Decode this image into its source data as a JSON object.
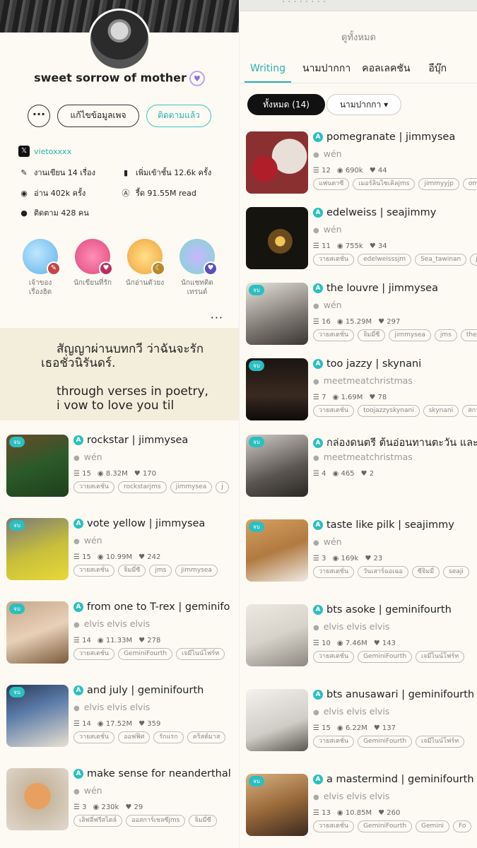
{
  "profile": {
    "name": "sweet sorrow of mother",
    "more_label": "···",
    "edit_label": "แก้ไขข้อมูลเพจ",
    "follow_label": "ติดตามแล้ว",
    "x_handle": "vietoxxxx",
    "stats": {
      "works": "งานเขียน 14 เรื่อง",
      "shelf": "เพิ่มเข้าชั้น 12.6k ครั้ง",
      "reads": "อ่าน 402k ครั้ง",
      "coins": "รี้ด 91.55M read",
      "followers": "ติดตาม 428 คน"
    },
    "badges": [
      {
        "line1": "เจ้าของ",
        "line2": "เรื่องฮิต"
      },
      {
        "line1": "นักเขียนที่รัก",
        "line2": ""
      },
      {
        "line1": "นักอ่านตัวยง",
        "line2": ""
      },
      {
        "line1": "นักแชทติด",
        "line2": "เทรนด์"
      }
    ],
    "bio_thai": "สัญญาผ่านบทกวี ว่าฉันจะรักเธอชั่วนิรันดร์.",
    "bio_en": "through verses in poetry, i vow to love you til"
  },
  "right_top": {
    "see_all": "ดูทั้งหมด",
    "tabs": [
      "Writing",
      "นามปากกา",
      "คอลเลคชัน",
      "อีบุ๊ก"
    ],
    "filter_all": "ทั้งหมด (14)",
    "filter_pen": "นามปากกา"
  },
  "done_label": "จบ",
  "stories_b": [
    {
      "title": "pomegranate | jimmysea",
      "author": "wén",
      "chapters": "12",
      "views": "690k",
      "likes": "44",
      "tags": [
        "แฟนตาซี",
        "เมอร์ลินไซเคิลjms",
        "jimmyyjp",
        "omeg"
      ],
      "done": false
    },
    {
      "title": "edelweiss | seajimmy",
      "author": "wén",
      "chapters": "11",
      "views": "755k",
      "likes": "34",
      "tags": [
        "วายสเตชั่น",
        "edelweisssjm",
        "Sea_tawinan",
        "jim"
      ],
      "done": false
    },
    {
      "title": "the louvre | jimmysea",
      "author": "wén",
      "chapters": "16",
      "views": "15.29M",
      "likes": "297",
      "tags": [
        "วายสเตชั่น",
        "จิมมี่ซี",
        "jimmysea",
        "jms",
        "thelou"
      ],
      "done": true
    },
    {
      "title": "too jazzy | skynani",
      "author": "meetmeatchristmas",
      "chapters": "7",
      "views": "1.69M",
      "likes": "78",
      "tags": [
        "วายสเตชั่น",
        "toojazzyskynani",
        "skynani",
        "สกาย"
      ],
      "done": true
    }
  ],
  "stories_c": [
    {
      "title": "rockstar | jimmysea",
      "author": "wén",
      "chapters": "15",
      "views": "8.32M",
      "likes": "170",
      "tags": [
        "วายสเตชั่น",
        "rockstarjms",
        "jimmysea",
        "j"
      ],
      "done": true
    },
    {
      "title": "vote yellow | jimmysea",
      "author": "wén",
      "chapters": "15",
      "views": "10.99M",
      "likes": "242",
      "tags": [
        "วายสเตชั่น",
        "จิมมี่ซี",
        "jms",
        "jimmysea"
      ],
      "done": true
    },
    {
      "title": "from one to T-rex | geminifo",
      "author": "elvis elvis elvis",
      "chapters": "14",
      "views": "11.33M",
      "likes": "278",
      "tags": [
        "วายสเตชั่น",
        "GeminiFourth",
        "เจมีไนน์โฟร์ท"
      ],
      "done": true
    },
    {
      "title": "and july | geminifourth",
      "author": "elvis elvis elvis",
      "chapters": "14",
      "views": "17.52M",
      "likes": "359",
      "tags": [
        "วายสเตชั่น",
        "ออฟฟิศ",
        "รักแรก",
        "คริสต์มาส"
      ],
      "done": true
    },
    {
      "title": "make sense for neanderthal",
      "author": "wén",
      "chapters": "3",
      "views": "230k",
      "likes": "29",
      "tags": [
        "เลิฟลี่ฟรีสไตล์",
        "ออสการ์เชลซีjms",
        "จิมมี่ซี"
      ],
      "done": false
    }
  ],
  "stories_d": [
    {
      "title": "กล่องดนตรี ต้นอ่อนทานตะวัน และส",
      "author": "meetmeatchristmas",
      "chapters": "4",
      "views": "465",
      "likes": "2",
      "tags": [],
      "done": true
    },
    {
      "title": "taste like pilk | seajimmy",
      "author": "wén",
      "chapters": "3",
      "views": "169k",
      "likes": "23",
      "tags": [
        "วายสเตชั่น",
        "วันเสาร์ฉอเฉอ",
        "ซีจิมมี่",
        "seaji"
      ],
      "done": true
    },
    {
      "title": "bts asoke | geminifourth",
      "author": "elvis elvis elvis",
      "chapters": "10",
      "views": "7.46M",
      "likes": "143",
      "tags": [
        "วายสเตชั่น",
        "GeminiFourth",
        "เจมีไนน์โฟร์ท"
      ],
      "done": false
    },
    {
      "title": "bts anusawari | geminifourth",
      "author": "elvis elvis elvis",
      "chapters": "15",
      "views": "6.22M",
      "likes": "137",
      "tags": [
        "วายสเตชั่น",
        "GeminiFourth",
        "เจมีไนน์โฟร์ท"
      ],
      "done": false
    },
    {
      "title": "a mastermind | geminifourth",
      "author": "elvis elvis elvis",
      "chapters": "13",
      "views": "10.85M",
      "likes": "260",
      "tags": [
        "วายสเตชั่น",
        "GeminiFourth",
        "Gemini",
        "Fo"
      ],
      "done": true
    }
  ],
  "colors": {
    "accent": "#2bbfbf",
    "bio_bg": "#f3eedb",
    "page_bg": "#fdfaf4"
  }
}
